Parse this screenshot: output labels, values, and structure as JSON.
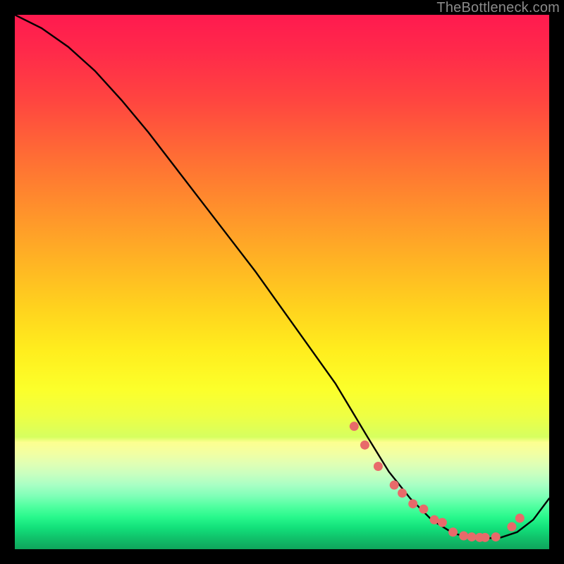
{
  "watermark": {
    "text": "TheBottleneck.com"
  },
  "chart_data": {
    "type": "line",
    "title": "",
    "xlabel": "",
    "ylabel": "",
    "x_range": [
      0,
      100
    ],
    "y_range": [
      0,
      100
    ],
    "grid": false,
    "legend": false,
    "series": [
      {
        "name": "curve",
        "x": [
          0,
          5,
          10,
          15,
          20,
          25,
          30,
          35,
          40,
          45,
          50,
          55,
          60,
          63,
          66,
          70,
          74,
          78,
          82,
          85,
          88,
          91,
          94,
          97,
          100
        ],
        "y": [
          100,
          97.5,
          94,
          89.5,
          84,
          78,
          71.5,
          65,
          58.5,
          52,
          45,
          38,
          31,
          26,
          21,
          14.5,
          9.5,
          5.5,
          3,
          2.2,
          2,
          2.2,
          3.2,
          5.5,
          9.5
        ]
      }
    ],
    "markers": {
      "name": "highlight-dots",
      "color": "#e86a6a",
      "radius": 6.5,
      "x": [
        63.5,
        65.5,
        68,
        71,
        72.5,
        74.5,
        76.5,
        78.5,
        80,
        82,
        84,
        85.5,
        87,
        88,
        90,
        93,
        94.5
      ],
      "y": [
        23,
        19.5,
        15.5,
        12,
        10.5,
        8.5,
        7.5,
        5.5,
        5,
        3.2,
        2.5,
        2.3,
        2.2,
        2.2,
        2.3,
        4.2,
        5.8
      ]
    }
  }
}
